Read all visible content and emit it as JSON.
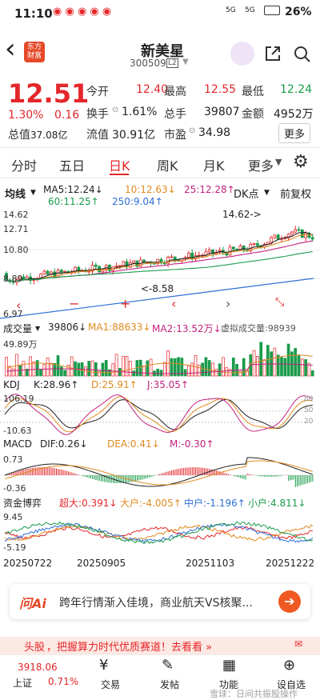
{
  "status": {
    "time": "11:10",
    "signal1": "5G",
    "signal2": "5G",
    "battery": "26%"
  },
  "header": {
    "back": "‹",
    "title": "新美星",
    "code": "300509",
    "code_tag": "L2",
    "logo_line1": "东方",
    "logo_line2": "财富"
  },
  "quote": {
    "price": "12.51",
    "pct": "1.30%",
    "chg": "0.16",
    "open_label": "今开",
    "open": "12.40",
    "high_label": "最高",
    "high": "12.55",
    "low_label": "最低",
    "low": "12.24",
    "turnover_label": "换手",
    "turnover": "1.61%",
    "volume_label": "总手",
    "volume": "39807",
    "amount_label": "金额",
    "amount": "4952万",
    "mcap_label": "总值",
    "mcap": "37.08亿",
    "float_label": "流值",
    "float": "30.91亿",
    "pe_label": "市盈",
    "pe": "34.98",
    "more": "更多"
  },
  "tabs": [
    "分时",
    "五日",
    "日K",
    "周K",
    "月K",
    "更多"
  ],
  "tabs_active": 2,
  "kline": {
    "ma_type": "均线",
    "ma5": "MA5:12.24↓",
    "ma10": "10:12.63↓",
    "ma25": "25:12.28↑",
    "ma60": "60:11.25↑",
    "ma250": "250:9.04↑",
    "dk": "DK点",
    "adj": "前复权",
    "y_labels": [
      "14.62",
      "12.71",
      "10.80",
      "8.89",
      "6.97"
    ],
    "max_note": "14.62->",
    "min_note": "<-8.58"
  },
  "volume": {
    "title": "成交量",
    "val": "39806↓",
    "ma1": "MA1:88633↓",
    "ma2": "MA2:13.52万↓",
    "virt": "虚拟成交量:98939",
    "ymax": "49.89万"
  },
  "kdj": {
    "title": "KDJ",
    "k": "K:28.96↑",
    "d": "D:25.91↑",
    "j": "J:35.05↑",
    "ytop": "106.19",
    "ybot": "-10.63",
    "r80": "80",
    "r50": "50",
    "r20": "20"
  },
  "macd": {
    "title": "MACD",
    "dif": "DIF:0.26↓",
    "dea": "DEA:0.41↓",
    "m": "M:-0.30↑",
    "ytop": "0.73",
    "ybot": "-0.36"
  },
  "fund": {
    "title": "资金博弈",
    "big": "超大:0.391↓",
    "large": "大户:-4.005↑",
    "mid": "中户:-1.196↑",
    "small": "小户:4.811↓",
    "ytop": "9.45",
    "ybot": "-5.19"
  },
  "dates": [
    "20250722",
    "20250905",
    "20251103",
    "20251222"
  ],
  "ai": {
    "logo": "问Ai",
    "text": "跨年行情渐入佳境，商业航天VS核聚..."
  },
  "banner": {
    "tag": "头股",
    "text": "，把握算力时代优质赛道！去看看 »"
  },
  "bottom": {
    "index_name": "上证",
    "index_val": "3918.06",
    "index_pct": "0.71%",
    "trade": "交易",
    "post": "发帖",
    "func": "功能",
    "settings": "设自选"
  },
  "watermark": "雪球：日间共振股操作",
  "colors": {
    "up": "#e4262a",
    "down": "#1a9b4b",
    "ma5": "#222222",
    "ma10": "#e08a1e",
    "ma25": "#c2227e",
    "ma60": "#1a9b4b",
    "ma250": "#2e6fd6"
  }
}
